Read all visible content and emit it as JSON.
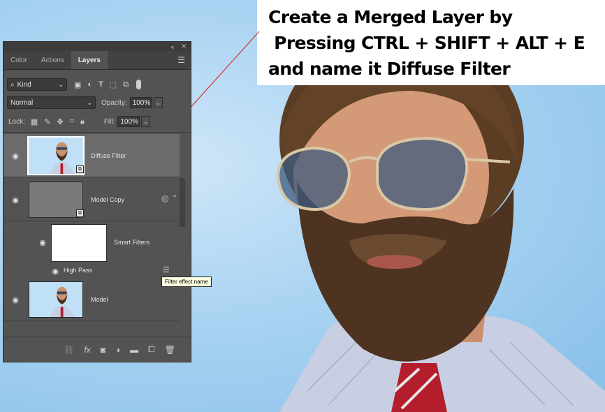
{
  "caption": {
    "lines": [
      "Create a Merged Layer by",
      " Pressing CTRL + SHIFT + ALT + E",
      "and name it Diffuse Filter"
    ]
  },
  "panel": {
    "collapse_icon": "double-chevron-icon",
    "close_label": "✕",
    "tabs": [
      {
        "label": "Color"
      },
      {
        "label": "Actions"
      },
      {
        "label": "Layers",
        "active": true
      }
    ],
    "filter": {
      "kind_label": "Kind"
    },
    "blend_mode": "Normal",
    "opacity_label": "Opacity:",
    "opacity_value": "100%",
    "lock_label": "Lock:",
    "fill_label": "Fill:",
    "fill_value": "100%",
    "layers": [
      {
        "name": "Diffuse Filter",
        "selected": true
      },
      {
        "name": "Model Copy",
        "selected": false
      },
      {
        "name": "Smart Filters",
        "selected": false
      },
      {
        "name": "High Pass",
        "selected": false
      },
      {
        "name": "Model",
        "selected": false
      }
    ],
    "tooltip": "Filter effect name"
  },
  "colors": {
    "panel_bg": "#535353",
    "selected_layer": "#6b6b6b",
    "pointer_line": "#d9332f"
  }
}
